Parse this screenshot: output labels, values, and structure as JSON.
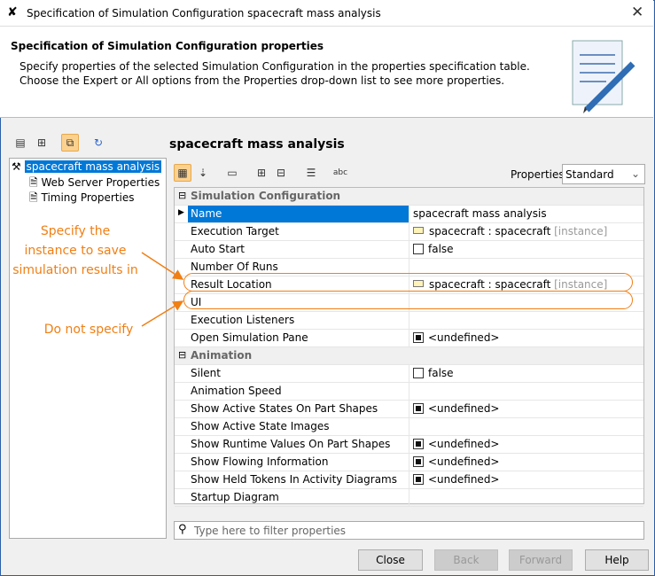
{
  "window": {
    "title": "Specification of Simulation Configuration spacecraft mass analysis"
  },
  "header": {
    "title": "Specification of Simulation Configuration properties",
    "description": "Specify properties of the selected Simulation Configuration in the properties specification table. Choose the Expert or All options from the Properties drop-down list to see more properties."
  },
  "tree": {
    "items": [
      "spacecraft mass analysis",
      "Web Server Properties",
      "Timing Properties"
    ]
  },
  "right": {
    "title": "spacecraft mass analysis",
    "properties_label": "Properties:",
    "properties_value": "Standard",
    "filter_placeholder": "Type here to filter properties"
  },
  "groups": [
    {
      "label": "Simulation Configuration",
      "rows": [
        {
          "label": "Name",
          "value": "spacecraft mass analysis",
          "type": "text"
        },
        {
          "label": "Execution Target",
          "value": "spacecraft : spacecraft",
          "suffix": "[instance]",
          "type": "inst"
        },
        {
          "label": "Auto Start",
          "value": "false",
          "type": "cb"
        },
        {
          "label": "Number Of Runs",
          "value": "",
          "type": "text"
        },
        {
          "label": "Result Location",
          "value": "spacecraft : spacecraft",
          "suffix": "[instance]",
          "type": "inst"
        },
        {
          "label": "UI",
          "value": "",
          "type": "text"
        },
        {
          "label": "Execution Listeners",
          "value": "",
          "type": "text"
        },
        {
          "label": "Open Simulation Pane",
          "value": "<undefined>",
          "type": "cbf"
        }
      ]
    },
    {
      "label": "Animation",
      "rows": [
        {
          "label": "Silent",
          "value": "false",
          "type": "cb"
        },
        {
          "label": "Animation Speed",
          "value": "",
          "type": "text"
        },
        {
          "label": "Show Active States On Part Shapes",
          "value": "<undefined>",
          "type": "cbf"
        },
        {
          "label": "Show Active State Images",
          "value": "",
          "type": "text"
        },
        {
          "label": "Show Runtime Values On Part Shapes",
          "value": "<undefined>",
          "type": "cbf"
        },
        {
          "label": "Show Flowing Information",
          "value": "<undefined>",
          "type": "cbf"
        },
        {
          "label": "Show Held Tokens In Activity Diagrams",
          "value": "<undefined>",
          "type": "cbf"
        },
        {
          "label": "Startup Diagram",
          "value": "",
          "type": "text"
        }
      ]
    }
  ],
  "annotations": {
    "specify": [
      "Specify the",
      "instance to save",
      "simulation results in"
    ],
    "do_not": "Do not specify"
  },
  "buttons": {
    "close": "Close",
    "back": "Back",
    "forward": "Forward",
    "help": "Help"
  },
  "colors": {
    "accent": "#f07f14",
    "selection": "#0078d7"
  }
}
